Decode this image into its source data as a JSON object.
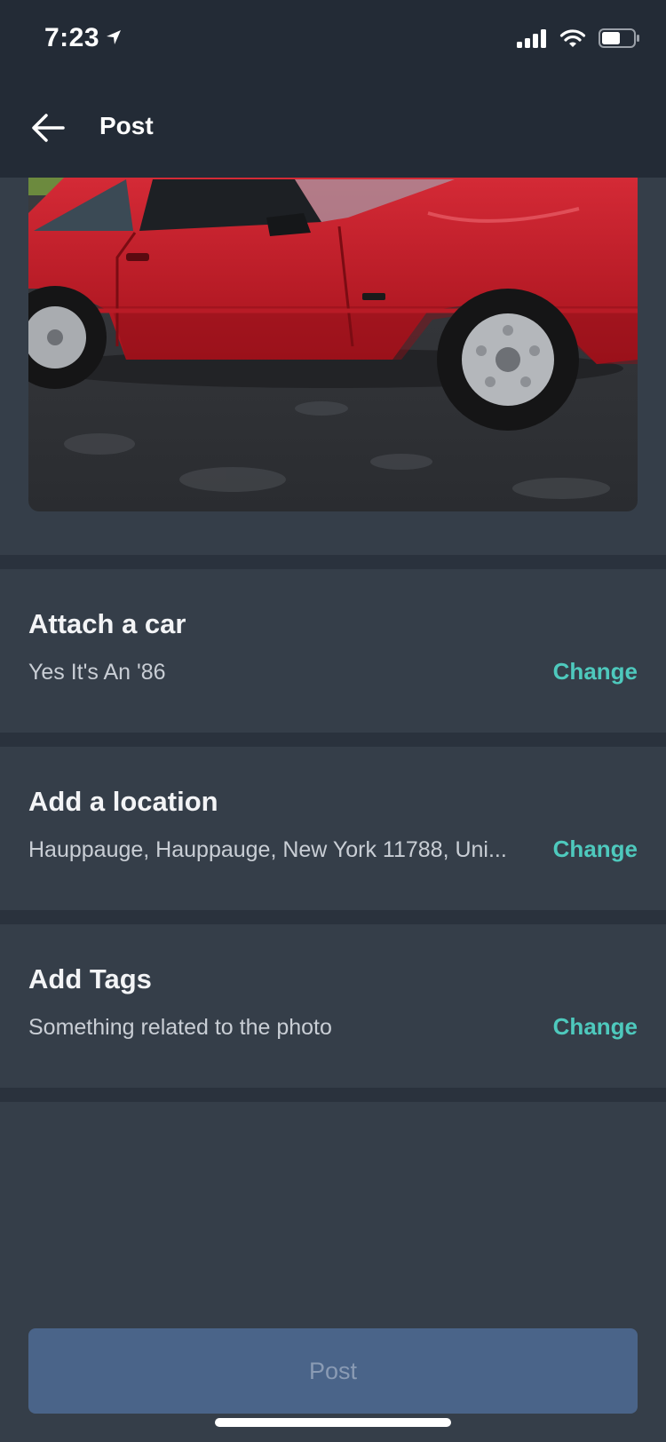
{
  "status_bar": {
    "time": "7:23"
  },
  "header": {
    "title": "Post"
  },
  "photo": {
    "subject": "red car on wet asphalt"
  },
  "sections": [
    {
      "title": "Attach a car",
      "value": "Yes It's An '86",
      "action": "Change"
    },
    {
      "title": "Add a location",
      "value": "Hauppauge, Hauppauge, New York 11788, Uni...",
      "action": "Change"
    },
    {
      "title": "Add Tags",
      "value": "Something related to the photo",
      "action": "Change"
    }
  ],
  "footer": {
    "post_label": "Post"
  },
  "colors": {
    "background": "#353e49",
    "header": "#232b36",
    "accent": "#4ec9bd",
    "button": "#4a6489",
    "button_text": "#8a9bb4"
  }
}
